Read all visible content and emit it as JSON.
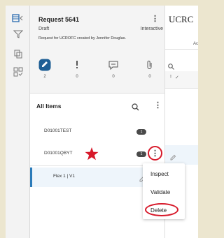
{
  "request": {
    "title": "Request 5641",
    "status": "Draft",
    "mode": "Interactive",
    "description": "Request for UCROFC created by Jennifer Douglas."
  },
  "stats": [
    {
      "icon": "edit-badge-icon",
      "count": "2"
    },
    {
      "icon": "exclamation-icon",
      "count": "0"
    },
    {
      "icon": "comment-icon",
      "count": "0"
    },
    {
      "icon": "attachment-icon",
      "count": "0"
    }
  ],
  "list": {
    "title": "All Items",
    "items": [
      {
        "label": "D01001TEST",
        "badge": "1"
      },
      {
        "label": "D01001QBYT",
        "badge": "1"
      }
    ],
    "selected": {
      "label": "Flex 1 | V1"
    }
  },
  "menu": {
    "items": [
      "Inspect",
      "Validate",
      "Delete"
    ]
  },
  "right_panel": {
    "title": "UCRC",
    "tab_fragment": "Ac"
  },
  "colors": {
    "accent_blue": "#1f5f95",
    "annotation_red": "#d7192a",
    "selected_bg": "#eef5fb"
  }
}
